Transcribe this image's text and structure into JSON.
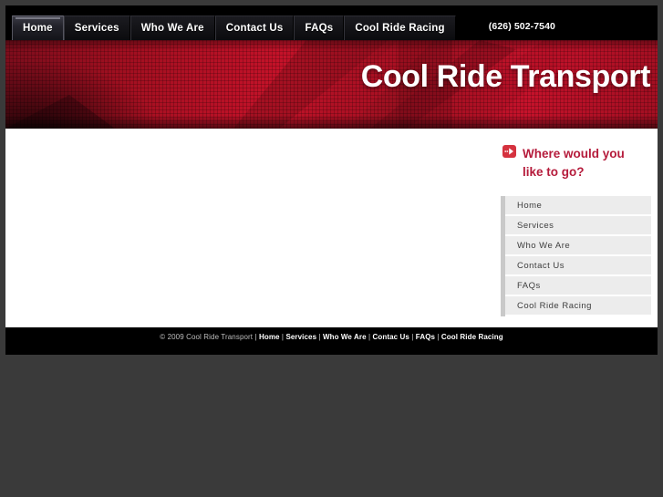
{
  "site": {
    "title": "Cool Ride Transport",
    "phone": "(626) 502-7540"
  },
  "colors": {
    "page_background": "#3a3a3a",
    "banner_red": "#c41229",
    "heading_red": "#b51b3b",
    "icon_red": "#d5323f",
    "sidebar_item_background": "#ececec",
    "sidebar_accent": "#c9c9c9",
    "footer_background": "#000000",
    "tab_active_background": "#3b3b45"
  },
  "nav": {
    "tabs": [
      {
        "label": "Home",
        "active": true
      },
      {
        "label": "Services",
        "active": false
      },
      {
        "label": "Who We Are",
        "active": false
      },
      {
        "label": "Contact Us",
        "active": false
      },
      {
        "label": "FAQs",
        "active": false
      },
      {
        "label": "Cool Ride Racing",
        "active": false
      }
    ]
  },
  "sidebar": {
    "heading_line1": "Where would you",
    "heading_line2": "like to go?",
    "heading_icon": "arrow-right-icon",
    "items": [
      {
        "label": "Home"
      },
      {
        "label": "Services"
      },
      {
        "label": "Who We Are"
      },
      {
        "label": "Contact Us"
      },
      {
        "label": "FAQs"
      },
      {
        "label": "Cool Ride Racing"
      }
    ]
  },
  "footer": {
    "copyright": "© 2009 Cool Ride Transport",
    "separator": " | ",
    "links": [
      "Home",
      "Services",
      "Who We Are",
      "Contac Us",
      "FAQs",
      "Cool Ride Racing"
    ]
  }
}
